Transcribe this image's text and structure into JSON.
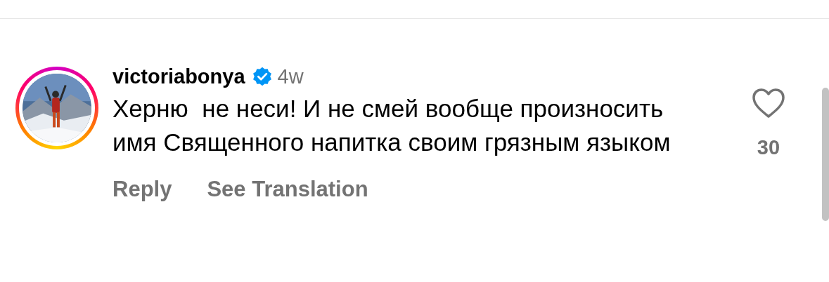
{
  "comment": {
    "username": "victoriabonya",
    "verified": true,
    "time": "4w",
    "text": "Херню  не неси! И не смей вообще произносить имя Священного напитка своим грязным языком",
    "liked": false,
    "like_count": "30",
    "actions": [
      "Reply",
      "See Translation"
    ]
  }
}
